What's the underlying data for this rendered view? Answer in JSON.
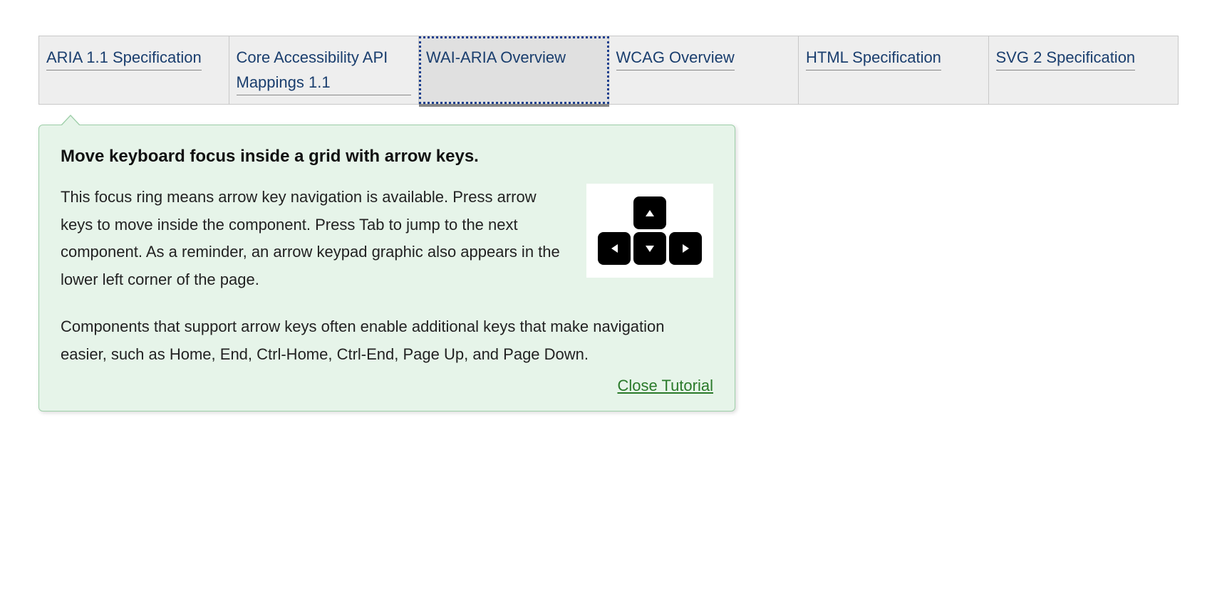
{
  "grid": {
    "cells": [
      {
        "label": "ARIA 1.1 Specification",
        "focused": false
      },
      {
        "label": "Core Accessibility API Mappings 1.1",
        "focused": false
      },
      {
        "label": "WAI-ARIA Overview",
        "focused": true
      },
      {
        "label": "WCAG Overview",
        "focused": false
      },
      {
        "label": "HTML Specification",
        "focused": false
      },
      {
        "label": "SVG 2 Specification",
        "focused": false
      }
    ]
  },
  "popover": {
    "heading": "Move keyboard focus inside a grid with arrow keys.",
    "paragraph1": "This focus ring means arrow key navigation is available. Press arrow keys to move inside the component. Press Tab to jump to the next component. As a reminder, an arrow keypad graphic also appears in the lower left corner of the page.",
    "paragraph2": "Components that support arrow keys often enable additional keys that make navigation easier, such as Home, End, Ctrl-Home, Ctrl-End, Page Up, and Page Down.",
    "close_label": "Close Tutorial"
  }
}
